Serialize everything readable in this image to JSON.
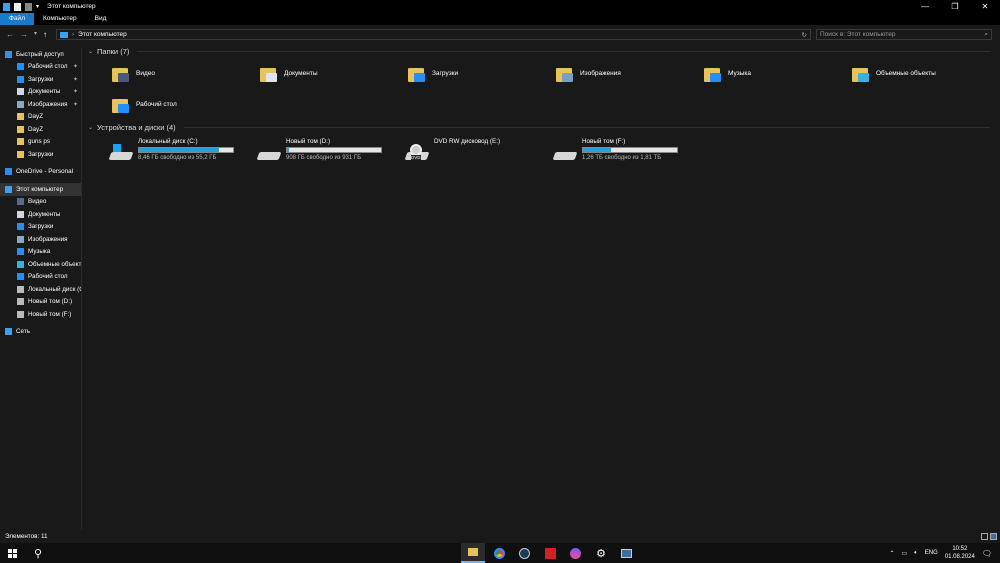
{
  "window": {
    "title": "Этот компьютер",
    "min": "—",
    "max": "❐",
    "close": "✕"
  },
  "ribbon": {
    "tabs": [
      "Файл",
      "Компьютер",
      "Вид"
    ]
  },
  "address": {
    "path": "Этот компьютер",
    "search_placeholder": "Поиск в: Этот компьютер"
  },
  "sidebar": {
    "items": [
      {
        "label": "Быстрый доступ",
        "level": 0,
        "color": "#3b8ee0"
      },
      {
        "label": "Рабочий стол",
        "level": 1,
        "pinned": true,
        "color": "#1e90ff"
      },
      {
        "label": "Загрузки",
        "level": 1,
        "pinned": true,
        "color": "#2a8ef0"
      },
      {
        "label": "Документы",
        "level": 1,
        "pinned": true,
        "color": "#cfd8e0"
      },
      {
        "label": "Изображения",
        "level": 1,
        "pinned": true,
        "color": "#8aa8c0"
      },
      {
        "label": "DayZ",
        "level": 1,
        "color": "#e8c25a"
      },
      {
        "label": "DayZ",
        "level": 1,
        "color": "#e8c25a"
      },
      {
        "label": "guns ps",
        "level": 1,
        "color": "#e8c25a"
      },
      {
        "label": "Загрузки",
        "level": 1,
        "color": "#e8c25a"
      },
      {
        "label": "OneDrive - Personal",
        "level": 0,
        "gap": true,
        "color": "#2a8ef0"
      },
      {
        "label": "Этот компьютер",
        "level": 0,
        "gap": true,
        "selected": true,
        "color": "#3aa0f0"
      },
      {
        "label": "Видео",
        "level": 1,
        "color": "#5a6a8a"
      },
      {
        "label": "Документы",
        "level": 1,
        "color": "#cfd8e0"
      },
      {
        "label": "Загрузки",
        "level": 1,
        "color": "#2a8ef0"
      },
      {
        "label": "Изображения",
        "level": 1,
        "color": "#8aa8c0"
      },
      {
        "label": "Музыка",
        "level": 1,
        "color": "#2a8ef0"
      },
      {
        "label": "Объемные объекты",
        "level": 1,
        "color": "#3ab0e0"
      },
      {
        "label": "Рабочий стол",
        "level": 1,
        "color": "#1e90ff"
      },
      {
        "label": "Локальный диск (C:)",
        "level": 1,
        "color": "#bbbbbb"
      },
      {
        "label": "Новый том (D:)",
        "level": 1,
        "color": "#bbbbbb"
      },
      {
        "label": "Новый том (F:)",
        "level": 1,
        "color": "#bbbbbb"
      },
      {
        "label": "Сеть",
        "level": 0,
        "gap": true,
        "color": "#3aa0f0"
      }
    ],
    "pin": "📌"
  },
  "folders": {
    "header": "Папки (7)",
    "items": [
      {
        "label": "Видео",
        "overlay": "#4a5a7a"
      },
      {
        "label": "Документы",
        "overlay": "#e0e6ee"
      },
      {
        "label": "Загрузки",
        "overlay": "#2a8ef0"
      },
      {
        "label": "Изображения",
        "overlay": "#7aa0c0"
      },
      {
        "label": "Музыка",
        "overlay": "#2a8ef0"
      },
      {
        "label": "Объемные объекты",
        "overlay": "#3ab0e0"
      },
      {
        "label": "Рабочий стол",
        "overlay": "#1e90ff"
      }
    ]
  },
  "drives": {
    "header": "Устройства и диски (4)",
    "items": [
      {
        "label": "Локальный диск (C:)",
        "free": "8,46 ГБ свободно из 55,2 ГБ",
        "used_pct": 85,
        "type": "system"
      },
      {
        "label": "Новый том (D:)",
        "free": "908 ГБ свободно из 931 ГБ",
        "used_pct": 2.5,
        "type": "hdd"
      },
      {
        "label": "DVD RW дисковод (E:)",
        "type": "dvd",
        "dvd_text": "DVD"
      },
      {
        "label": "Новый том (F:)",
        "free": "1,26 ТБ свободно из 1,81 ТБ",
        "used_pct": 30,
        "type": "hdd"
      }
    ]
  },
  "status": {
    "count": "Элементов: 11"
  },
  "taskbar": {
    "lang": "ENG",
    "time": "10:52",
    "date": "01.08.2024"
  }
}
